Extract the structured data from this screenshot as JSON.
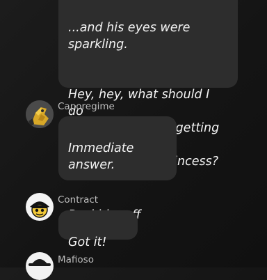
{
  "messages": [
    {
      "author": "",
      "paragraphs": [
        "...and his eyes were sparkling.",
        "Hey, hey, what should I do\nif that brat starts getting all\nclingy with the Princess?"
      ]
    },
    {
      "author": "Caporegime",
      "avatar_icon": "golden-figure-avatar-icon",
      "paragraphs": [
        "Immediate answer.",
        "Peel him off her."
      ]
    },
    {
      "author": "Contract",
      "avatar_icon": "hat-figure-avatar-icon",
      "paragraphs": [
        "Got it!"
      ]
    },
    {
      "author": "Mafioso",
      "avatar_icon": "fedora-avatar-icon",
      "paragraphs": []
    }
  ]
}
